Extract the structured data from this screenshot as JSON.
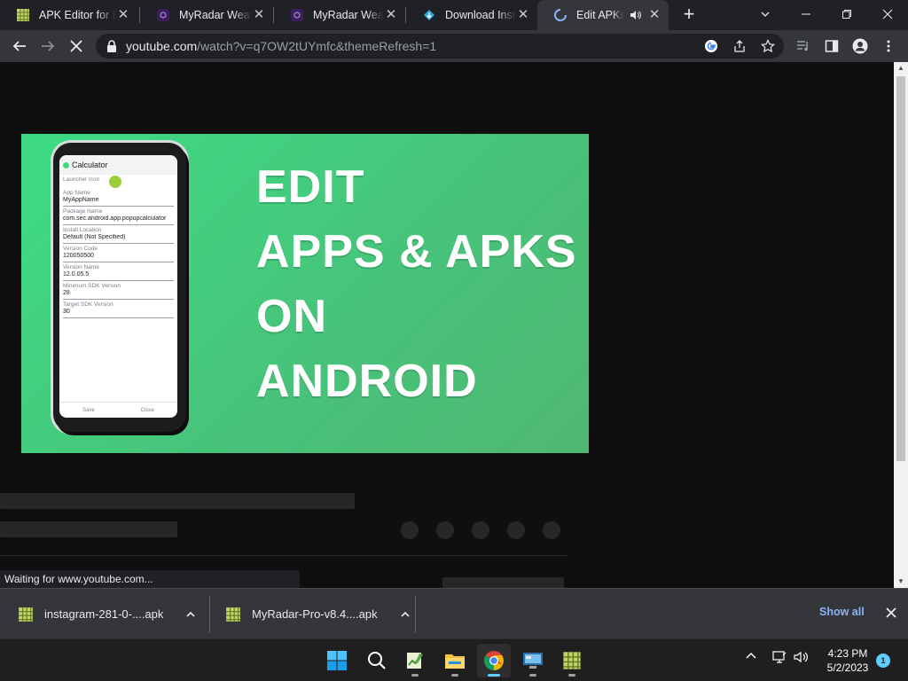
{
  "tabs": [
    {
      "title": "APK Editor for P",
      "favicon": "apk-editor-icon"
    },
    {
      "title": "MyRadar Weath",
      "favicon": "myradar-icon"
    },
    {
      "title": "MyRadar Weath",
      "favicon": "myradar-icon"
    },
    {
      "title": "Download Insta",
      "favicon": "download-site-icon"
    },
    {
      "title": "Edit APKs o",
      "favicon": "loading-spinner-icon",
      "active": true,
      "audio": true
    }
  ],
  "address_bar": {
    "host": "youtube.com",
    "path": "/watch?v=q7OW2tUYmfc&themeRefresh=1"
  },
  "video": {
    "headline_lines": [
      "EDIT",
      "APPS & APKS",
      "ON",
      "ANDROID"
    ],
    "phone_app_title": "Calculator",
    "phone_fields": [
      {
        "label": "Launcher Icon",
        "value": ""
      },
      {
        "label": "App Name",
        "value": "MyAppName"
      },
      {
        "label": "Package Name",
        "value": "com.sec.android.app.popupcalculator"
      },
      {
        "label": "Install Location",
        "value": "Default (Not Specified)"
      },
      {
        "label": "Version Code",
        "value": "120050500"
      },
      {
        "label": "Version Name",
        "value": "12.0.05.5"
      },
      {
        "label": "Minimum SDK Version",
        "value": "28"
      },
      {
        "label": "Target SDK Version",
        "value": "30"
      }
    ],
    "phone_buttons": [
      "Save",
      "Close"
    ]
  },
  "status_text": "Waiting for www.youtube.com...",
  "downloads": [
    {
      "name": "instagram-281-0-....apk"
    },
    {
      "name": "MyRadar-Pro-v8.4....apk"
    }
  ],
  "show_all_label": "Show all",
  "clock": {
    "time": "4:23 PM",
    "date": "5/2/2023"
  },
  "notification_count": "1",
  "colors": {
    "thumb_green": "#3ddc84",
    "link_blue": "#8ab4f8",
    "win_accent": "#60cdff"
  }
}
